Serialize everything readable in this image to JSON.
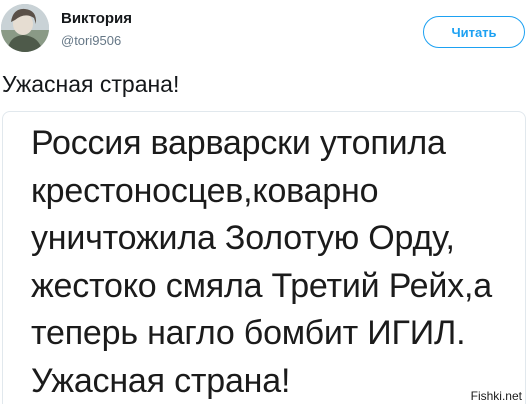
{
  "user": {
    "display_name": "Виктория",
    "handle": "@tori9506"
  },
  "follow_button": {
    "label": "Читать"
  },
  "tweet": {
    "text": "Ужасная страна!"
  },
  "media": {
    "lines": [
      "Россия варварски утопила",
      "крестоносцев,коварно",
      "уничтожила Золотую Орду,",
      "жестоко смяла Третий Рейх,а",
      "теперь нагло бомбит ИГИЛ.",
      "Ужасная страна!"
    ]
  },
  "watermark": {
    "text": "Fishki.net"
  },
  "colors": {
    "accent": "#1da1f2",
    "handle": "#657786",
    "text": "#14171a",
    "card_border": "#e1e8ed"
  }
}
